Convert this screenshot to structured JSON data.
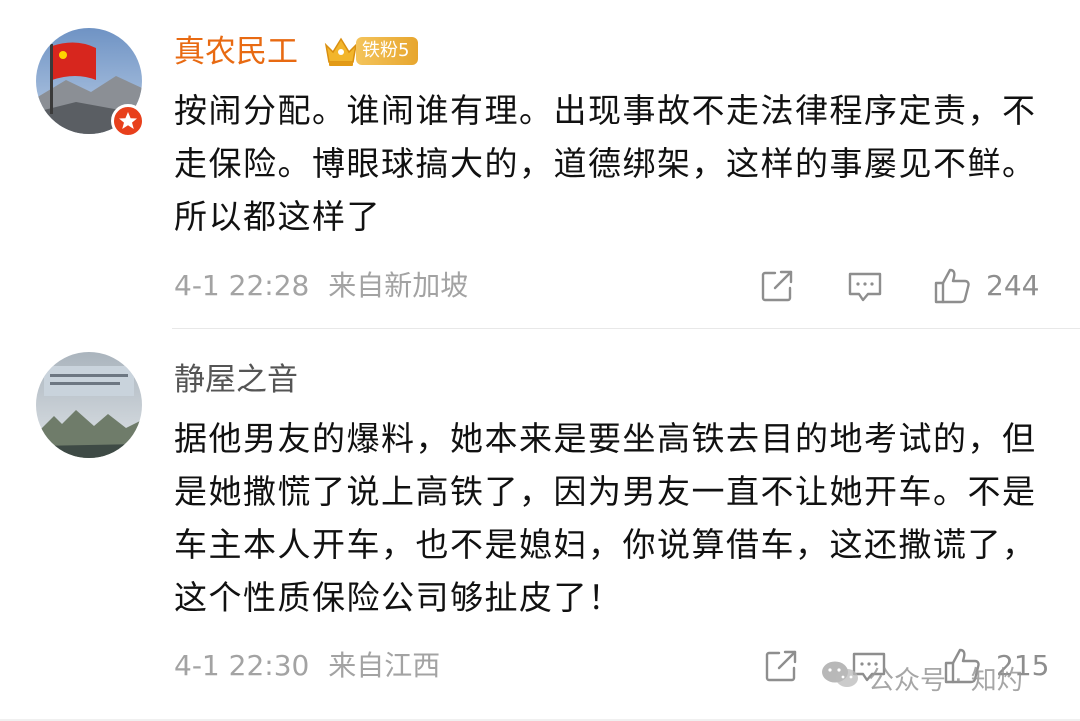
{
  "comments": [
    {
      "username": "真农民工",
      "fan_badge": "铁粉5",
      "text": "按闹分配。谁闹谁有理。出现事故不走法律程序定责，不走保险。博眼球搞大的，道德绑架，这样的事屡见不鲜。所以都这样了",
      "time": "4-1 22:28",
      "source": "来自新加坡",
      "likes": "244"
    },
    {
      "username": "静屋之音",
      "text": "据他男友的爆料，她本来是要坐高铁去目的地考试的，但是她撒慌了说上高铁了，因为男友一直不让她开车。不是车主本人开车，也不是媳妇，你说算借车，这还撒谎了，这个性质保险公司够扯皮了！",
      "time": "4-1 22:30",
      "source": "来自江西",
      "likes": "215"
    }
  ],
  "watermark": {
    "text": "公众号 · 知灼"
  },
  "colors": {
    "vip_name": "#e86a12",
    "normal_name": "#555555",
    "meta": "#a3a3a3",
    "icon": "#8e8e8e",
    "badge": "#e7a62e"
  },
  "icons": {
    "share": "share-icon",
    "comment": "comment-icon",
    "like": "thumbs-up-icon",
    "crown": "crown-icon",
    "verified": "verified-badge-icon"
  }
}
